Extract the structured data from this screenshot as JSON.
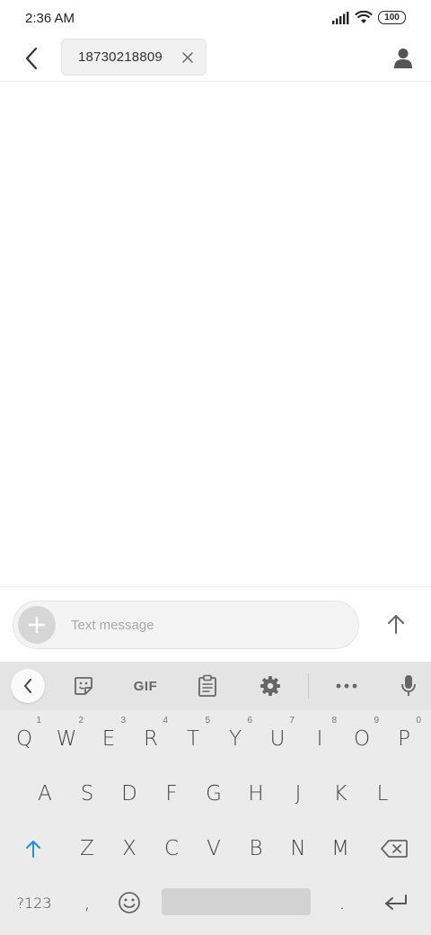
{
  "status_bar": {
    "time": "2:36 AM",
    "battery": "100"
  },
  "header": {
    "recipient": "18730218809",
    "back_icon": "chevron-left-icon",
    "contact_icon": "person-icon"
  },
  "compose": {
    "placeholder": "Text message",
    "attach_icon": "plus-icon",
    "send_icon": "arrow-up-icon"
  },
  "keyboard": {
    "toolbar": {
      "gif_label": "GIF",
      "items": [
        "chevron-left-icon",
        "sticker-icon",
        "gif",
        "clipboard-icon",
        "gear-icon",
        "more-icon",
        "microphone-icon"
      ]
    },
    "row1": [
      {
        "label": "Q",
        "hint": "1"
      },
      {
        "label": "W",
        "hint": "2"
      },
      {
        "label": "E",
        "hint": "3"
      },
      {
        "label": "R",
        "hint": "4"
      },
      {
        "label": "T",
        "hint": "5"
      },
      {
        "label": "Y",
        "hint": "6"
      },
      {
        "label": "U",
        "hint": "7"
      },
      {
        "label": "I",
        "hint": "8"
      },
      {
        "label": "O",
        "hint": "9"
      },
      {
        "label": "P",
        "hint": "0"
      }
    ],
    "row2": [
      "A",
      "S",
      "D",
      "F",
      "G",
      "H",
      "J",
      "K",
      "L"
    ],
    "row3": [
      "Z",
      "X",
      "C",
      "V",
      "B",
      "N",
      "M"
    ],
    "symbols_label": "?123",
    "comma_label": ",",
    "period_label": ".",
    "accent_color": "#2a8ae0"
  }
}
